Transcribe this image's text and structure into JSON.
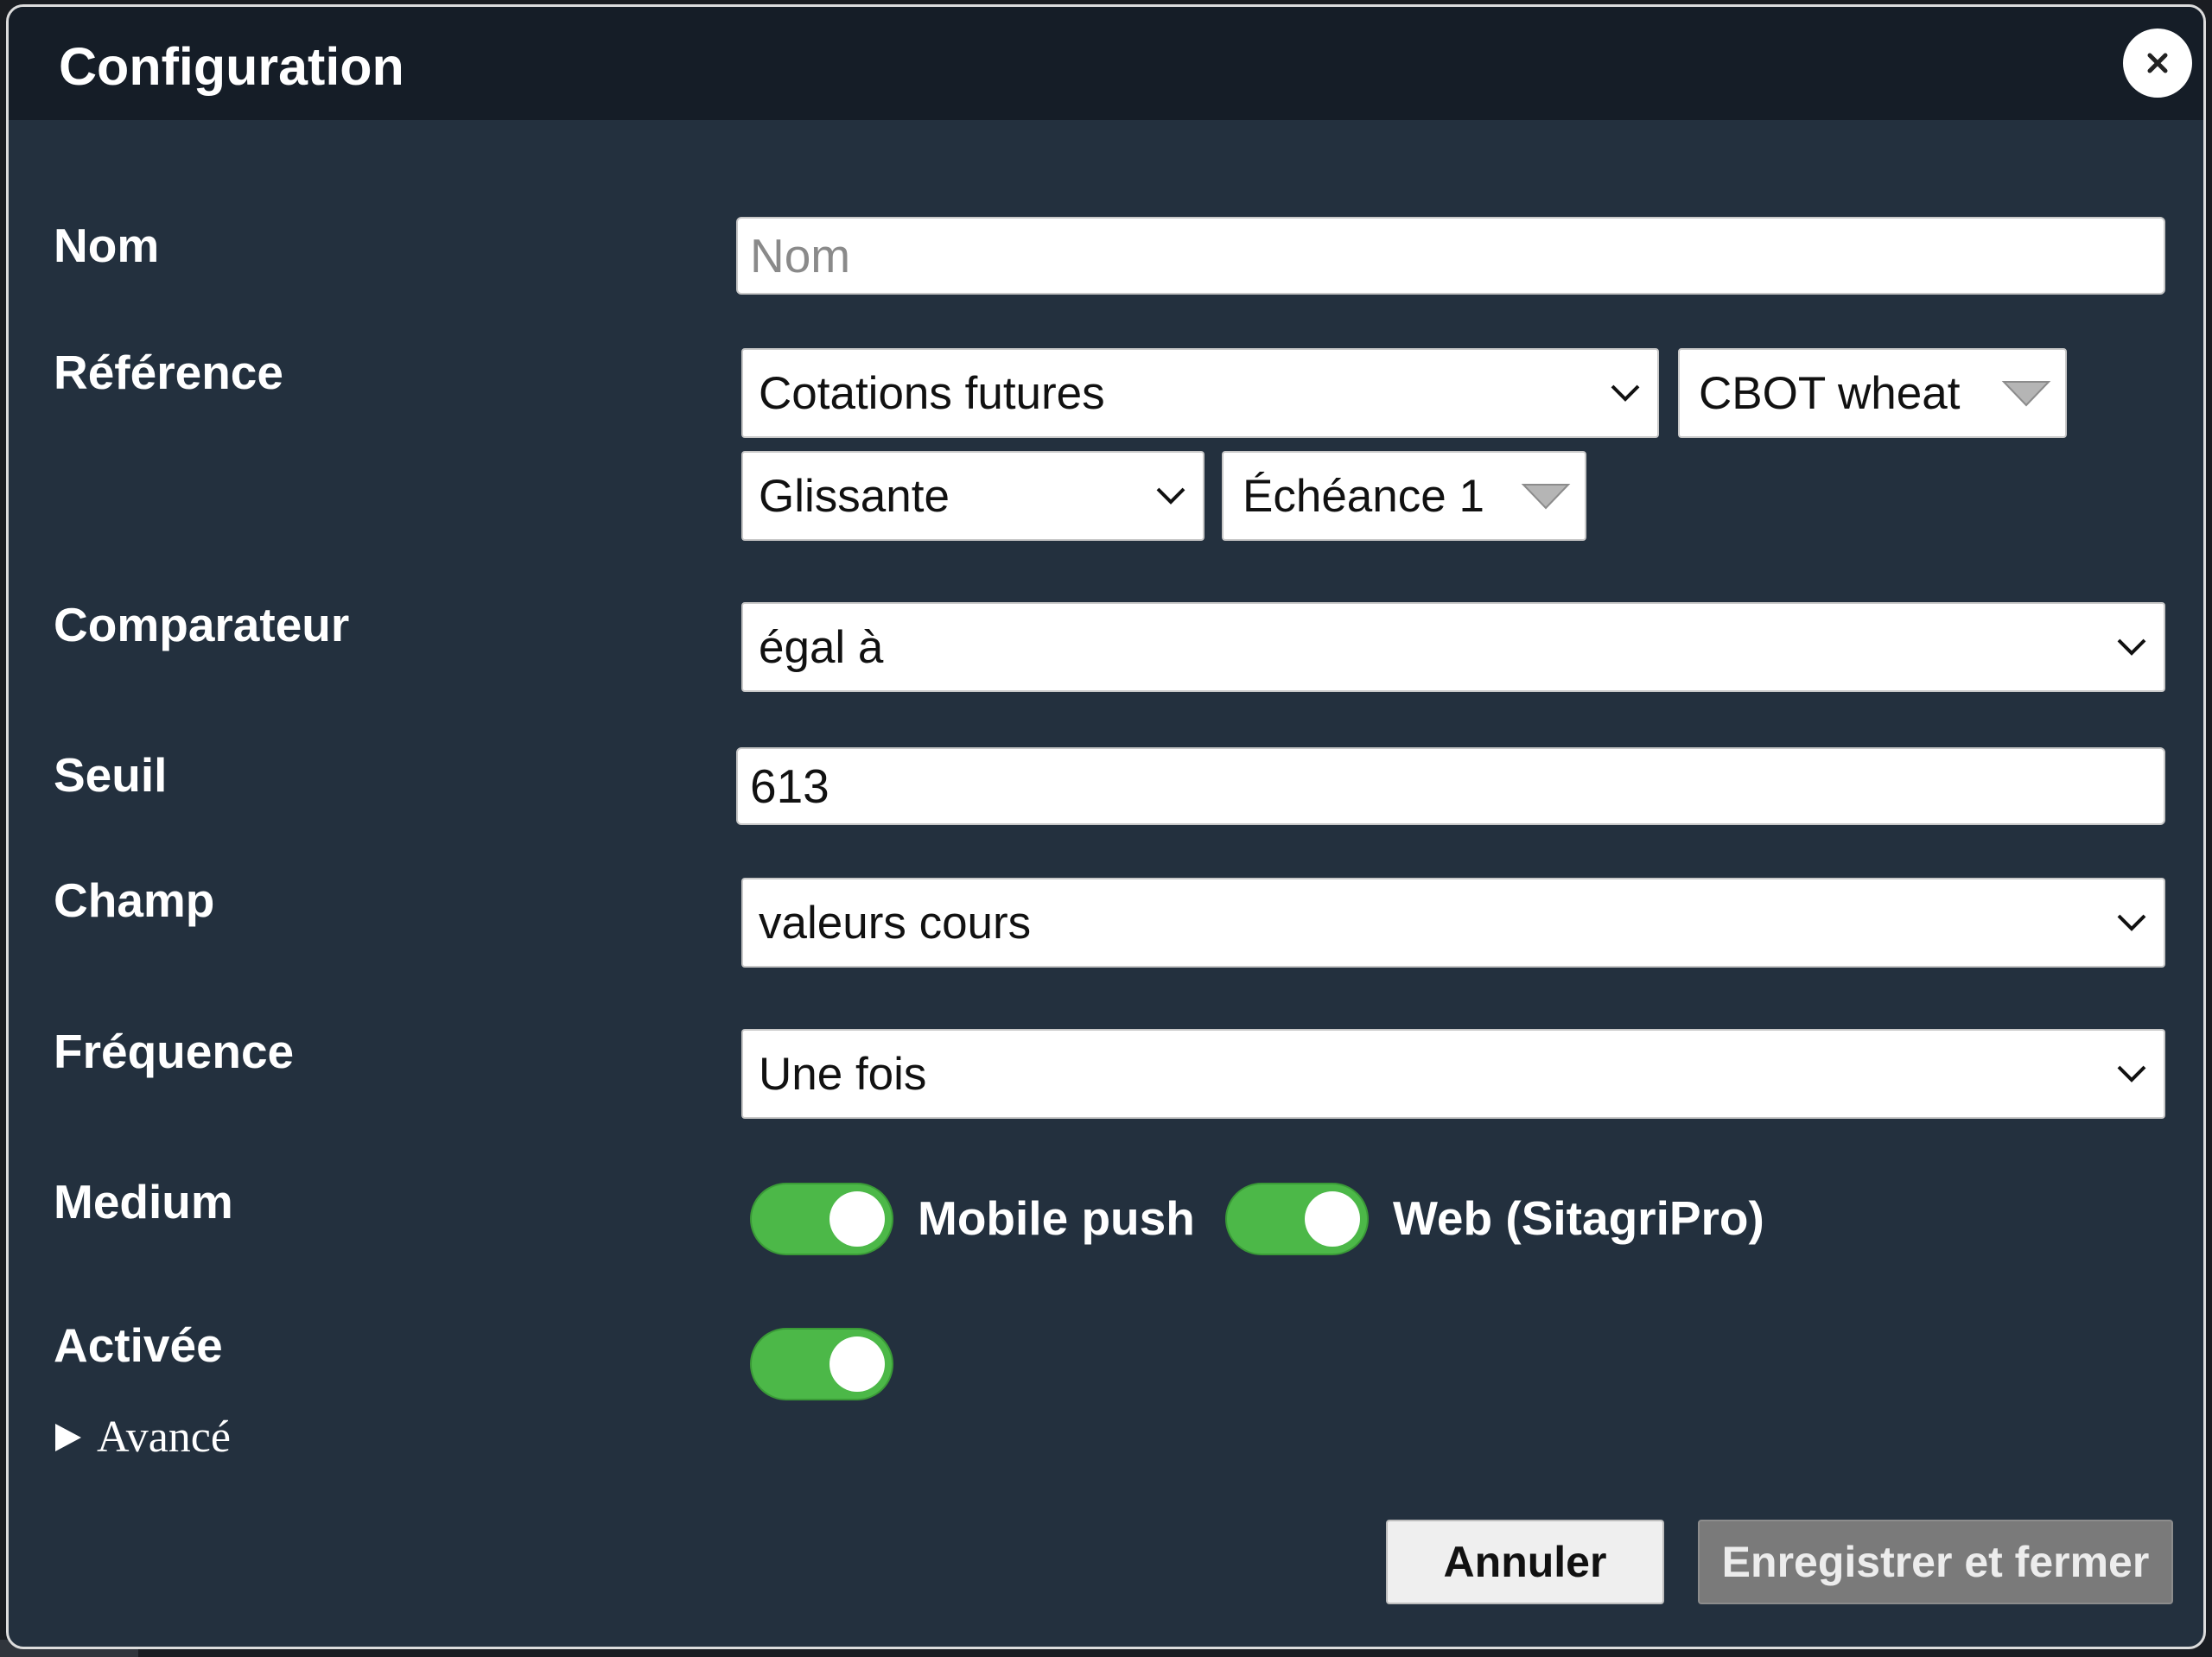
{
  "dialog": {
    "title": "Configuration",
    "close_icon": "close-icon"
  },
  "form": {
    "nom": {
      "label": "Nom",
      "placeholder": "Nom",
      "value": ""
    },
    "reference": {
      "label": "Référence",
      "type_select": "Cotations futures",
      "market_select": "CBOT wheat",
      "mode_select": "Glissante",
      "maturity_select": "Échéance 1"
    },
    "comparateur": {
      "label": "Comparateur",
      "value": "égal à"
    },
    "seuil": {
      "label": "Seuil",
      "value": "613"
    },
    "champ": {
      "label": "Champ",
      "value": "valeurs cours"
    },
    "frequence": {
      "label": "Fréquence",
      "value": "Une fois"
    },
    "medium": {
      "label": "Medium",
      "options": [
        {
          "label": "Mobile push",
          "enabled": true
        },
        {
          "label": "Web (SitagriPro)",
          "enabled": true
        }
      ]
    },
    "activee": {
      "label": "Activée",
      "enabled": true
    },
    "advanced": {
      "label": "Avancé",
      "expanded": false
    }
  },
  "footer": {
    "cancel_label": "Annuler",
    "save_label": "Enregistrer et fermer"
  },
  "colors": {
    "dialog_bg": "#23303e",
    "titlebar_bg": "#151d27",
    "toggle_on": "#4cb848",
    "save_button_disabled": "#7a7a7a"
  }
}
